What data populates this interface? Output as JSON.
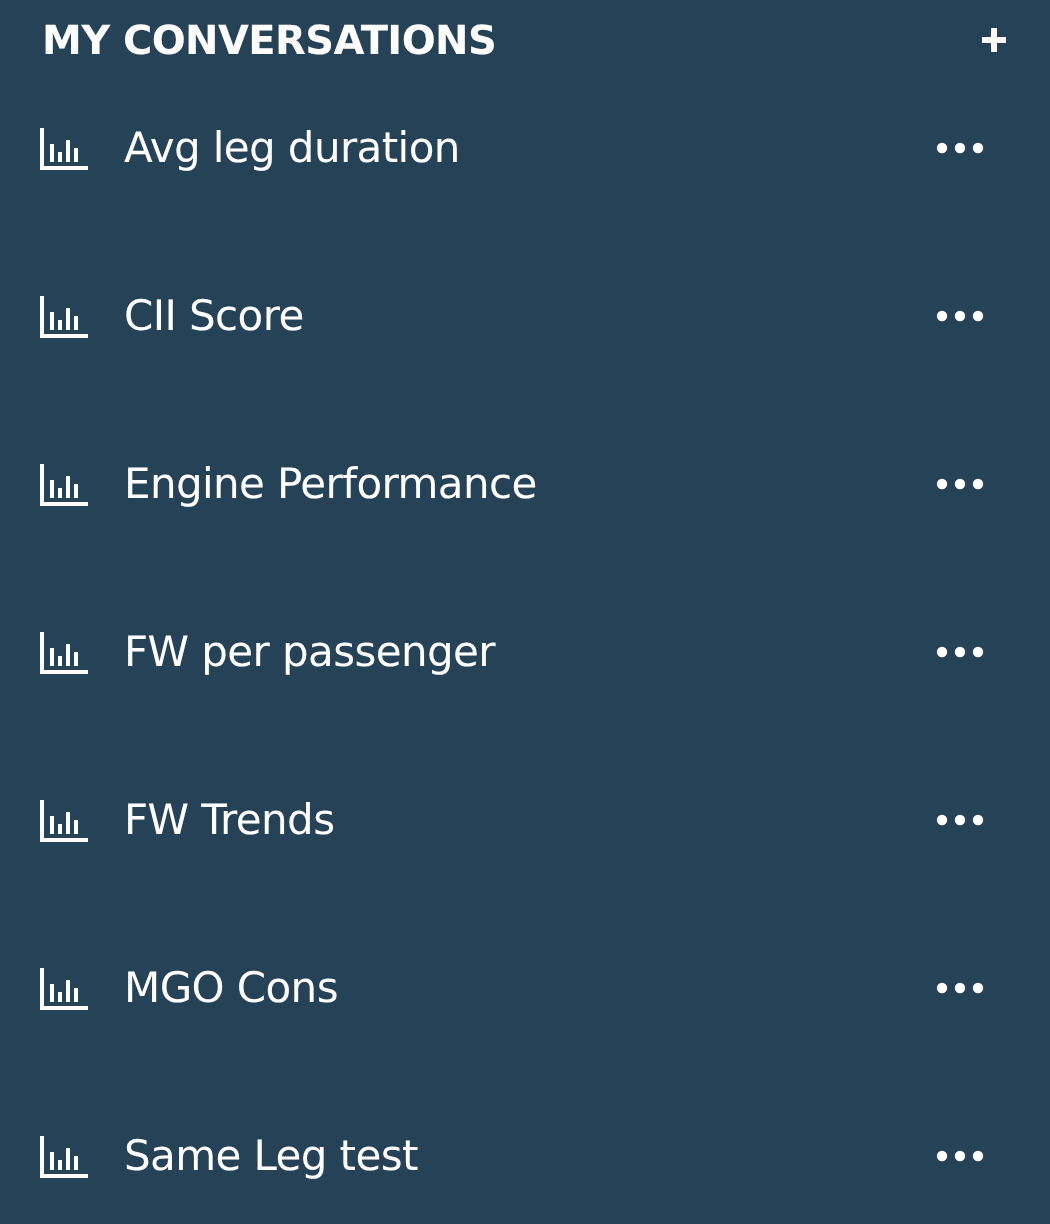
{
  "header": {
    "title": "MY CONVERSATIONS"
  },
  "conversations": [
    {
      "label": "Avg leg duration"
    },
    {
      "label": "CII Score"
    },
    {
      "label": "Engine Performance"
    },
    {
      "label": "FW per passenger"
    },
    {
      "label": "FW Trends"
    },
    {
      "label": "MGO Cons"
    },
    {
      "label": "Same Leg test"
    }
  ]
}
